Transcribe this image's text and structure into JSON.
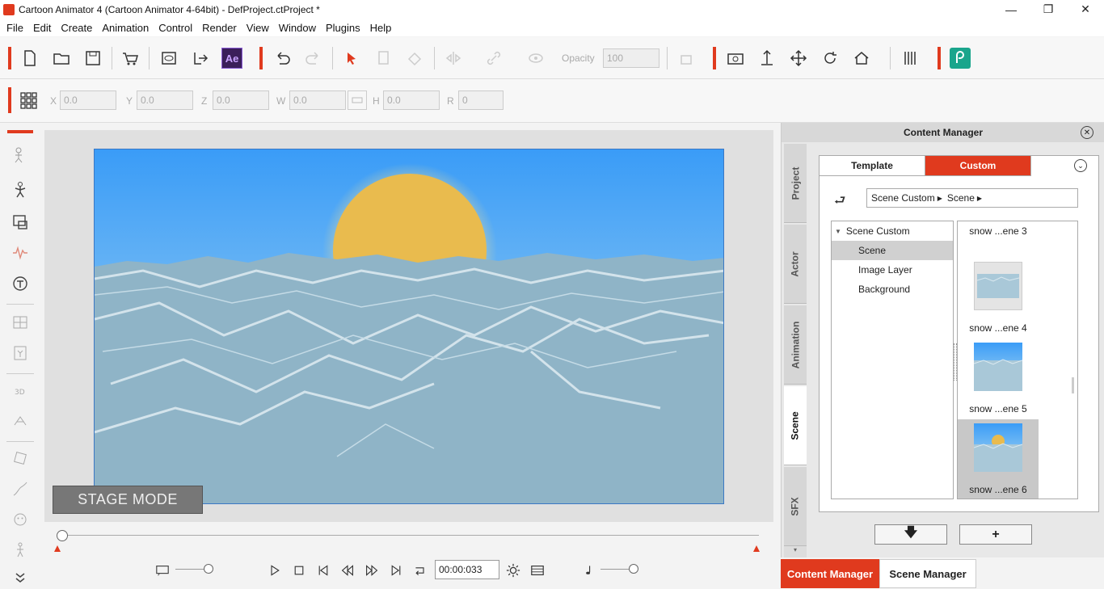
{
  "window": {
    "title": "Cartoon Animator 4  (Cartoon Animator 4-64bit) - DefProject.ctProject *",
    "minimize": "—",
    "restore": "❐",
    "close": "✕"
  },
  "menu": [
    "File",
    "Edit",
    "Create",
    "Animation",
    "Control",
    "Render",
    "View",
    "Window",
    "Plugins",
    "Help"
  ],
  "toolbar": {
    "ae_label": "Ae",
    "opacity_label": "Opacity",
    "opacity_value": "100"
  },
  "transform": {
    "x_label": "X",
    "x_value": "0.0",
    "y_label": "Y",
    "y_value": "0.0",
    "z_label": "Z",
    "z_value": "0.0",
    "w_label": "W",
    "w_value": "0.0",
    "h_label": "H",
    "h_value": "0.0",
    "r_label": "R",
    "r_value": "0"
  },
  "stage": {
    "mode_label": "STAGE MODE"
  },
  "transport": {
    "time": "00:00:033"
  },
  "content_manager": {
    "title": "Content Manager",
    "side_tabs": [
      "Project",
      "Actor",
      "Animation",
      "Scene",
      "SFX"
    ],
    "active_side_tab": "Scene",
    "tabs": {
      "template": "Template",
      "custom": "Custom"
    },
    "breadcrumb": [
      "Scene Custom",
      "Scene"
    ],
    "tree": {
      "root": "Scene Custom",
      "children": [
        "Scene",
        "Image Layer",
        "Background"
      ]
    },
    "items": [
      {
        "label": "snow ...ene 3"
      },
      {
        "label": "snow ...ene 4"
      },
      {
        "label": "snow ...ene 5"
      },
      {
        "label": "snow ...ene 6"
      }
    ],
    "buttons": {
      "download": "🡇",
      "add": "+"
    }
  },
  "bottom_tabs": {
    "content_manager": "Content Manager",
    "scene_manager": "Scene Manager"
  },
  "colors": {
    "accent": "#e03a1e",
    "sky_top": "#3a9cf7",
    "sky_bottom": "#b7def0",
    "sun": "#e9bb4e",
    "snow": "#8fb4c7"
  }
}
